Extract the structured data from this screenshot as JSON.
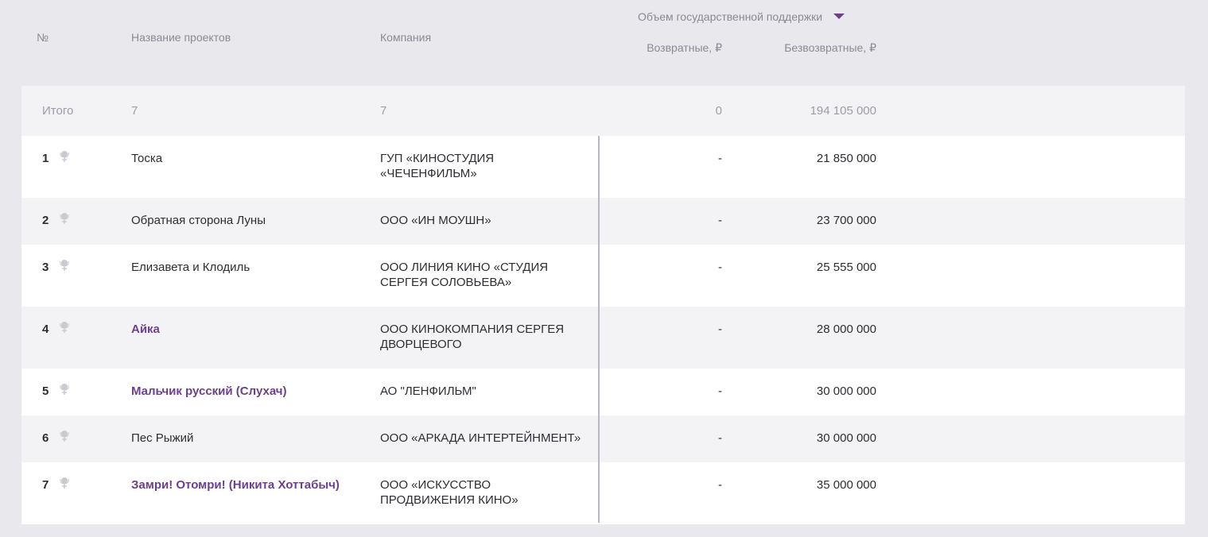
{
  "header": {
    "num": "№",
    "name": "Название проектов",
    "company": "Компания",
    "support_group": "Объем государственной поддержки",
    "returnable": "Возвратные, ₽",
    "nonreturnable": "Безвозвратные, ₽"
  },
  "total": {
    "label": "Итого",
    "projects": "7",
    "companies": "7",
    "returnable": "0",
    "nonreturnable": "194 105 000"
  },
  "rows": [
    {
      "num": "1",
      "name": "Тоска",
      "company": "ГУП «КИНОСТУДИЯ «ЧЕЧЕНФИЛЬМ»",
      "returnable": "-",
      "nonreturnable": "21 850 000"
    },
    {
      "num": "2",
      "name": "Обратная сторона Луны",
      "company": "ООО «ИН МОУШН»",
      "returnable": "-",
      "nonreturnable": "23 700 000"
    },
    {
      "num": "3",
      "name": "Елизавета и Клодиль",
      "company": "ООО ЛИНИЯ КИНО «СТУДИЯ СЕРГЕЯ СОЛОВЬЕВА»",
      "returnable": "-",
      "nonreturnable": "25 555 000"
    },
    {
      "num": "4",
      "name": "Айка",
      "company": "ООО КИНОКОМПАНИЯ СЕРГЕЯ ДВОРЦЕВОГО",
      "returnable": "-",
      "nonreturnable": "28 000 000"
    },
    {
      "num": "5",
      "name": "Мальчик русский (Слухач)",
      "company": "АО \"ЛЕНФИЛЬМ\"",
      "returnable": "-",
      "nonreturnable": "30 000 000"
    },
    {
      "num": "6",
      "name": "Пес Рыжий",
      "company": "ООО «АРКАДА ИНТЕРТЕЙНМЕНТ»",
      "returnable": "-",
      "nonreturnable": "30 000 000"
    },
    {
      "num": "7",
      "name": "Замри! Отомри! (Никита Хоттабыч)",
      "company": "ООО «ИСКУССТВО ПРОДВИЖЕНИЯ КИНО»",
      "returnable": "-",
      "nonreturnable": "35 000 000"
    }
  ],
  "icons": {
    "award": "award-icon",
    "caret": "caret-down-icon"
  },
  "colors": {
    "link": "#6d3f8f",
    "page_bg": "#e8e8ed"
  }
}
